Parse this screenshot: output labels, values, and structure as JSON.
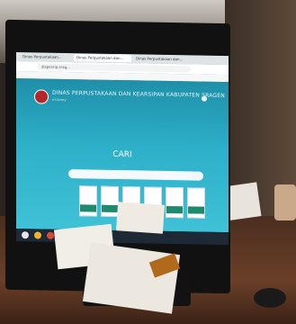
{
  "browser": {
    "tabs": [
      {
        "label": "Dinas Perpustakaan..."
      },
      {
        "label": "Dinas Perpustakaan dan..."
      },
      {
        "label": "Dinas Perpustakaan dan..."
      }
    ],
    "url": "dispersip.srag..."
  },
  "site": {
    "title": "DINAS PERPUSTAKAAN DAN KEARSIPAN KABUPATEN SRAGEN",
    "subtitle": "e-Library"
  },
  "search": {
    "heading": "CARI",
    "hint": "..."
  },
  "colors": {
    "page_bg": "#2aa6c2",
    "logo": "#b3262b",
    "book_band": "#1d8a6e"
  }
}
